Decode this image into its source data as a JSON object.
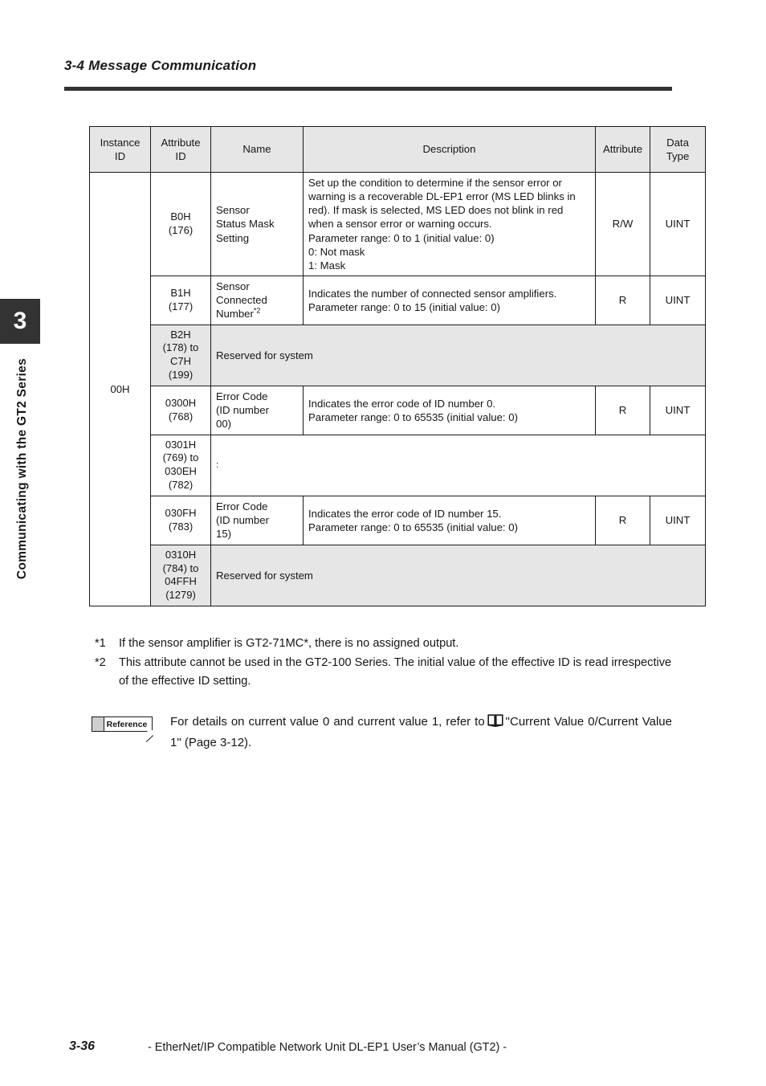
{
  "sidebar": {
    "chapter_number": "3",
    "chapter_title": "Communicating with the GT2 Series"
  },
  "header": {
    "section_title": "3-4 Message Communication"
  },
  "table": {
    "columns": [
      "Instance\nID",
      "Attribute\nID",
      "Name",
      "Description",
      "Attribute",
      "Data\nType"
    ],
    "instance_id": "00H",
    "rows": [
      {
        "attribute_id": "B0H\n(176)",
        "name": "Sensor\nStatus Mask\nSetting",
        "description": "Set up the condition to determine if the sensor error or warning is a recoverable DL-EP1 error (MS LED blinks in red). If mask is selected, MS LED does not blink in red when a sensor error or warning occurs.\nParameter range: 0 to 1 (initial value: 0)\n0: Not mask\n1: Mask",
        "attribute": "R/W",
        "data_type": "UINT"
      },
      {
        "attribute_id": "B1H\n(177)",
        "name": "Sensor\nConnected\nNumber",
        "name_superscript": "*2",
        "description": "Indicates the number of connected sensor amplifiers.\nParameter range: 0 to 15 (initial value: 0)",
        "attribute": "R",
        "data_type": "UINT"
      },
      {
        "attribute_id": "B2H\n(178) to\nC7H\n(199)",
        "reserved_text": "Reserved for system"
      },
      {
        "attribute_id": "0300H\n(768)",
        "name": "Error Code\n(ID number\n00)",
        "description": "Indicates the error code of ID number 0.\nParameter range: 0 to 65535 (initial value: 0)",
        "attribute": "R",
        "data_type": "UINT"
      },
      {
        "attribute_id": "0301H\n(769) to\n030EH\n(782)",
        "continuation_marker": ":"
      },
      {
        "attribute_id": "030FH\n(783)",
        "name": "Error Code\n(ID number\n15)",
        "description": "Indicates the error code of ID number 15.\nParameter range: 0 to 65535 (initial value: 0)",
        "attribute": "R",
        "data_type": "UINT"
      },
      {
        "attribute_id": "0310H\n(784) to\n04FFH\n(1279)",
        "reserved_text": "Reserved for system"
      }
    ]
  },
  "footnotes": [
    {
      "mark": "*1",
      "text": "If the sensor amplifier is GT2-71MC*, there is no assigned output."
    },
    {
      "mark": "*2",
      "text": "This attribute cannot be used in the GT2-100 Series. The initial value of the effective ID is read irrespective of the effective ID setting."
    }
  ],
  "reference": {
    "badge_label": "Reference",
    "text_before_icon": "For details on current value 0 and current value 1, refer to",
    "text_after_icon": "\"Current Value 0/Current Value 1\" (Page 3-12)."
  },
  "footer": {
    "page_number": "3-36",
    "manual_title": "- EtherNet/IP Compatible Network Unit DL-EP1 User’s Manual (GT2) -"
  }
}
